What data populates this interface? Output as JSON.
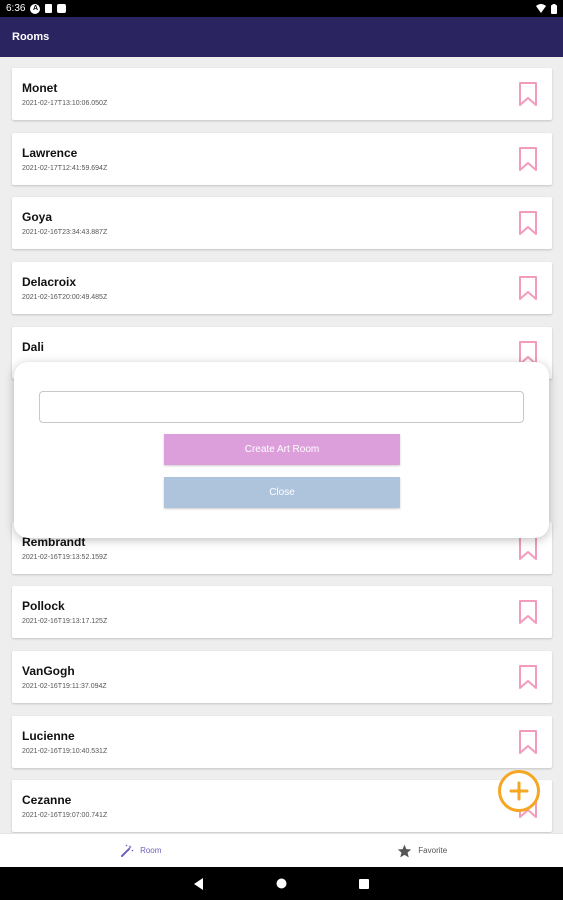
{
  "status_bar": {
    "time": "6:36",
    "app_icon_letter": "A"
  },
  "app_bar": {
    "title": "Rooms"
  },
  "rooms": [
    {
      "name": "Monet",
      "date": "2021-02-17T13:10:06.050Z"
    },
    {
      "name": "Lawrence",
      "date": "2021-02-17T12:41:59.694Z"
    },
    {
      "name": "Goya",
      "date": "2021-02-16T23:34:43.887Z"
    },
    {
      "name": "Delacroix",
      "date": "2021-02-16T20:00:49.485Z"
    },
    {
      "name": "Dali",
      "date": ""
    },
    {
      "name": "Rembrandt",
      "date": "2021-02-16T19:13:52.159Z"
    },
    {
      "name": "Pollock",
      "date": "2021-02-16T19:13:17.125Z"
    },
    {
      "name": "VanGogh",
      "date": "2021-02-16T19:11:37.094Z"
    },
    {
      "name": "Lucienne",
      "date": "2021-02-16T19:10:40.531Z"
    },
    {
      "name": "Cezanne",
      "date": "2021-02-16T19:07:00.741Z"
    }
  ],
  "dialog": {
    "input_value": "",
    "create_label": "Create Art Room",
    "close_label": "Close"
  },
  "bottom_nav": {
    "room_label": "Room",
    "favorite_label": "Favorite"
  },
  "colors": {
    "app_bar": "#2a2460",
    "bookmark": "#f29bbd",
    "create_button": "#dc9fdc",
    "close_button": "#aec3dc",
    "fab_accent": "#f5a623",
    "nav_active": "#6f5fc0"
  },
  "icons": {
    "bookmark": "bookmark-outline-icon",
    "fab": "add-circle-icon",
    "room_tab": "magic-wand-icon",
    "favorite_tab": "star-icon"
  }
}
